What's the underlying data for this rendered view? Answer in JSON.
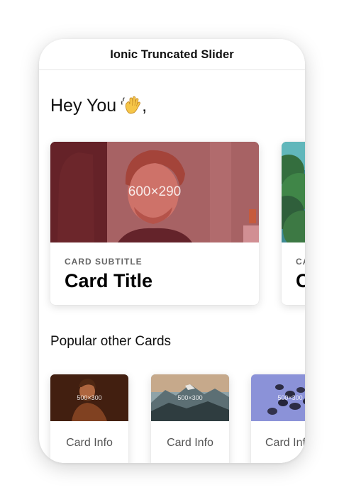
{
  "toolbar": {
    "title": "Ionic Truncated Slider"
  },
  "greeting": {
    "text": "Hey You",
    "punctuation": ",",
    "emoji_icon": "waving-hand-icon"
  },
  "featured_cards": [
    {
      "image_label": "600×290",
      "subtitle": "CARD SUBTITLE",
      "title": "Card Title"
    },
    {
      "image_label": "",
      "subtitle": "CA",
      "title": "C"
    }
  ],
  "popular": {
    "title": "Popular other Cards",
    "cards": [
      {
        "image_label": "500×300",
        "info": "Card Info"
      },
      {
        "image_label": "500×300",
        "info": "Card Info"
      },
      {
        "image_label": "500×300",
        "info": "Card Inf"
      }
    ]
  },
  "colors": {
    "accent_tint_red": "#c8384a",
    "accent_tint_blue": "#5d6fd8"
  }
}
